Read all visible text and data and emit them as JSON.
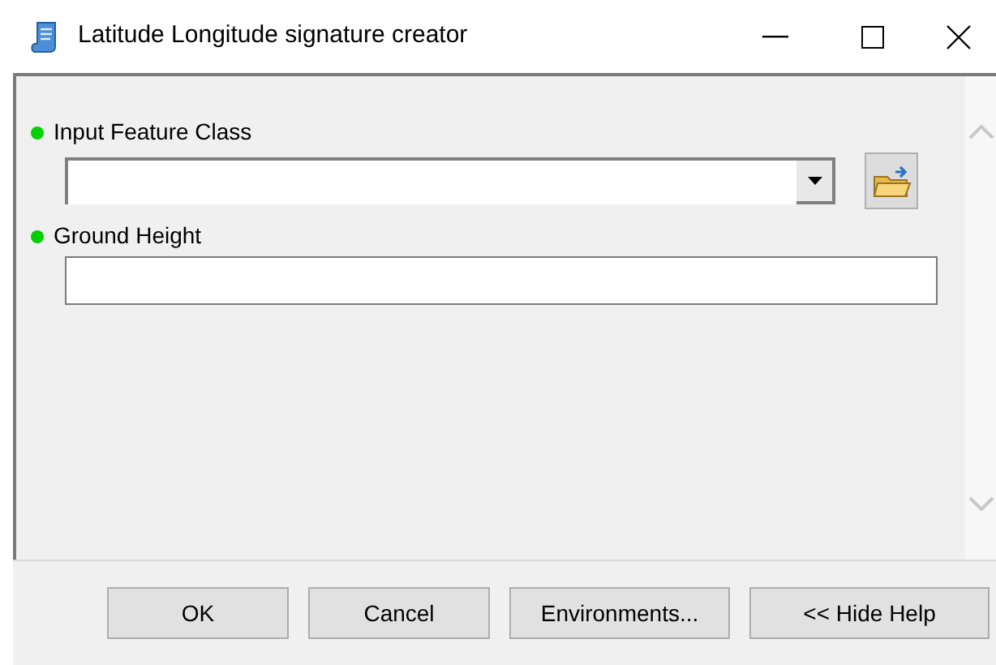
{
  "window": {
    "title": "Latitude Longitude signature creator"
  },
  "parameters": [
    {
      "label": "Input Feature Class",
      "kind": "dropdown",
      "color": "#00d000"
    },
    {
      "label": "Ground Height",
      "kind": "text",
      "color": "#00d000"
    }
  ],
  "buttons": [
    "OK",
    "Cancel",
    "Environments...",
    "<< Hide Help"
  ]
}
